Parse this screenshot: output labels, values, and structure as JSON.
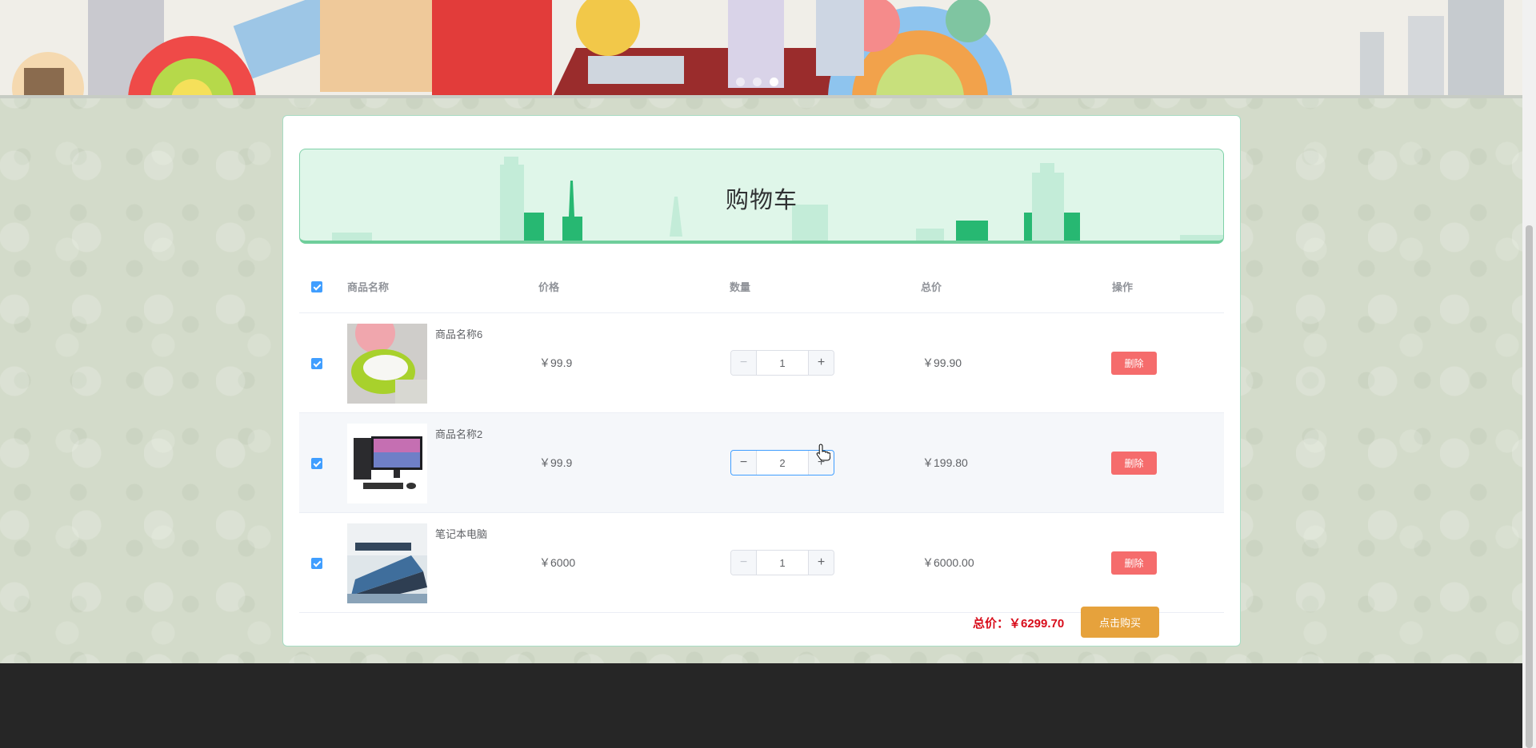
{
  "banner": {
    "slide_count": 3,
    "active_slide": 3
  },
  "cart": {
    "title": "购物车",
    "columns": {
      "name": "商品名称",
      "price": "价格",
      "quantity": "数量",
      "total": "总价",
      "action": "操作"
    },
    "items": [
      {
        "name": "商品名称6",
        "price": "￥99.9",
        "quantity": "1",
        "total": "￥99.90",
        "delete_label": "删除",
        "checked": true
      },
      {
        "name": "商品名称2",
        "price": "￥99.9",
        "quantity": "2",
        "total": "￥199.80",
        "delete_label": "删除",
        "checked": true
      },
      {
        "name": "笔记本电脑",
        "price": "￥6000",
        "quantity": "1",
        "total": "￥6000.00",
        "delete_label": "删除",
        "checked": true
      }
    ],
    "total_label": "总价：￥6299.70",
    "buy_label": "点击购买"
  },
  "colors": {
    "accent": "#409eff",
    "danger": "#f56c6c",
    "warning": "#e6a23c",
    "total_red": "#d80d1b",
    "header_green": "#dff6e9"
  },
  "icons": [
    "checkbox-icon",
    "minus-icon",
    "plus-icon",
    "hand-cursor-icon"
  ]
}
